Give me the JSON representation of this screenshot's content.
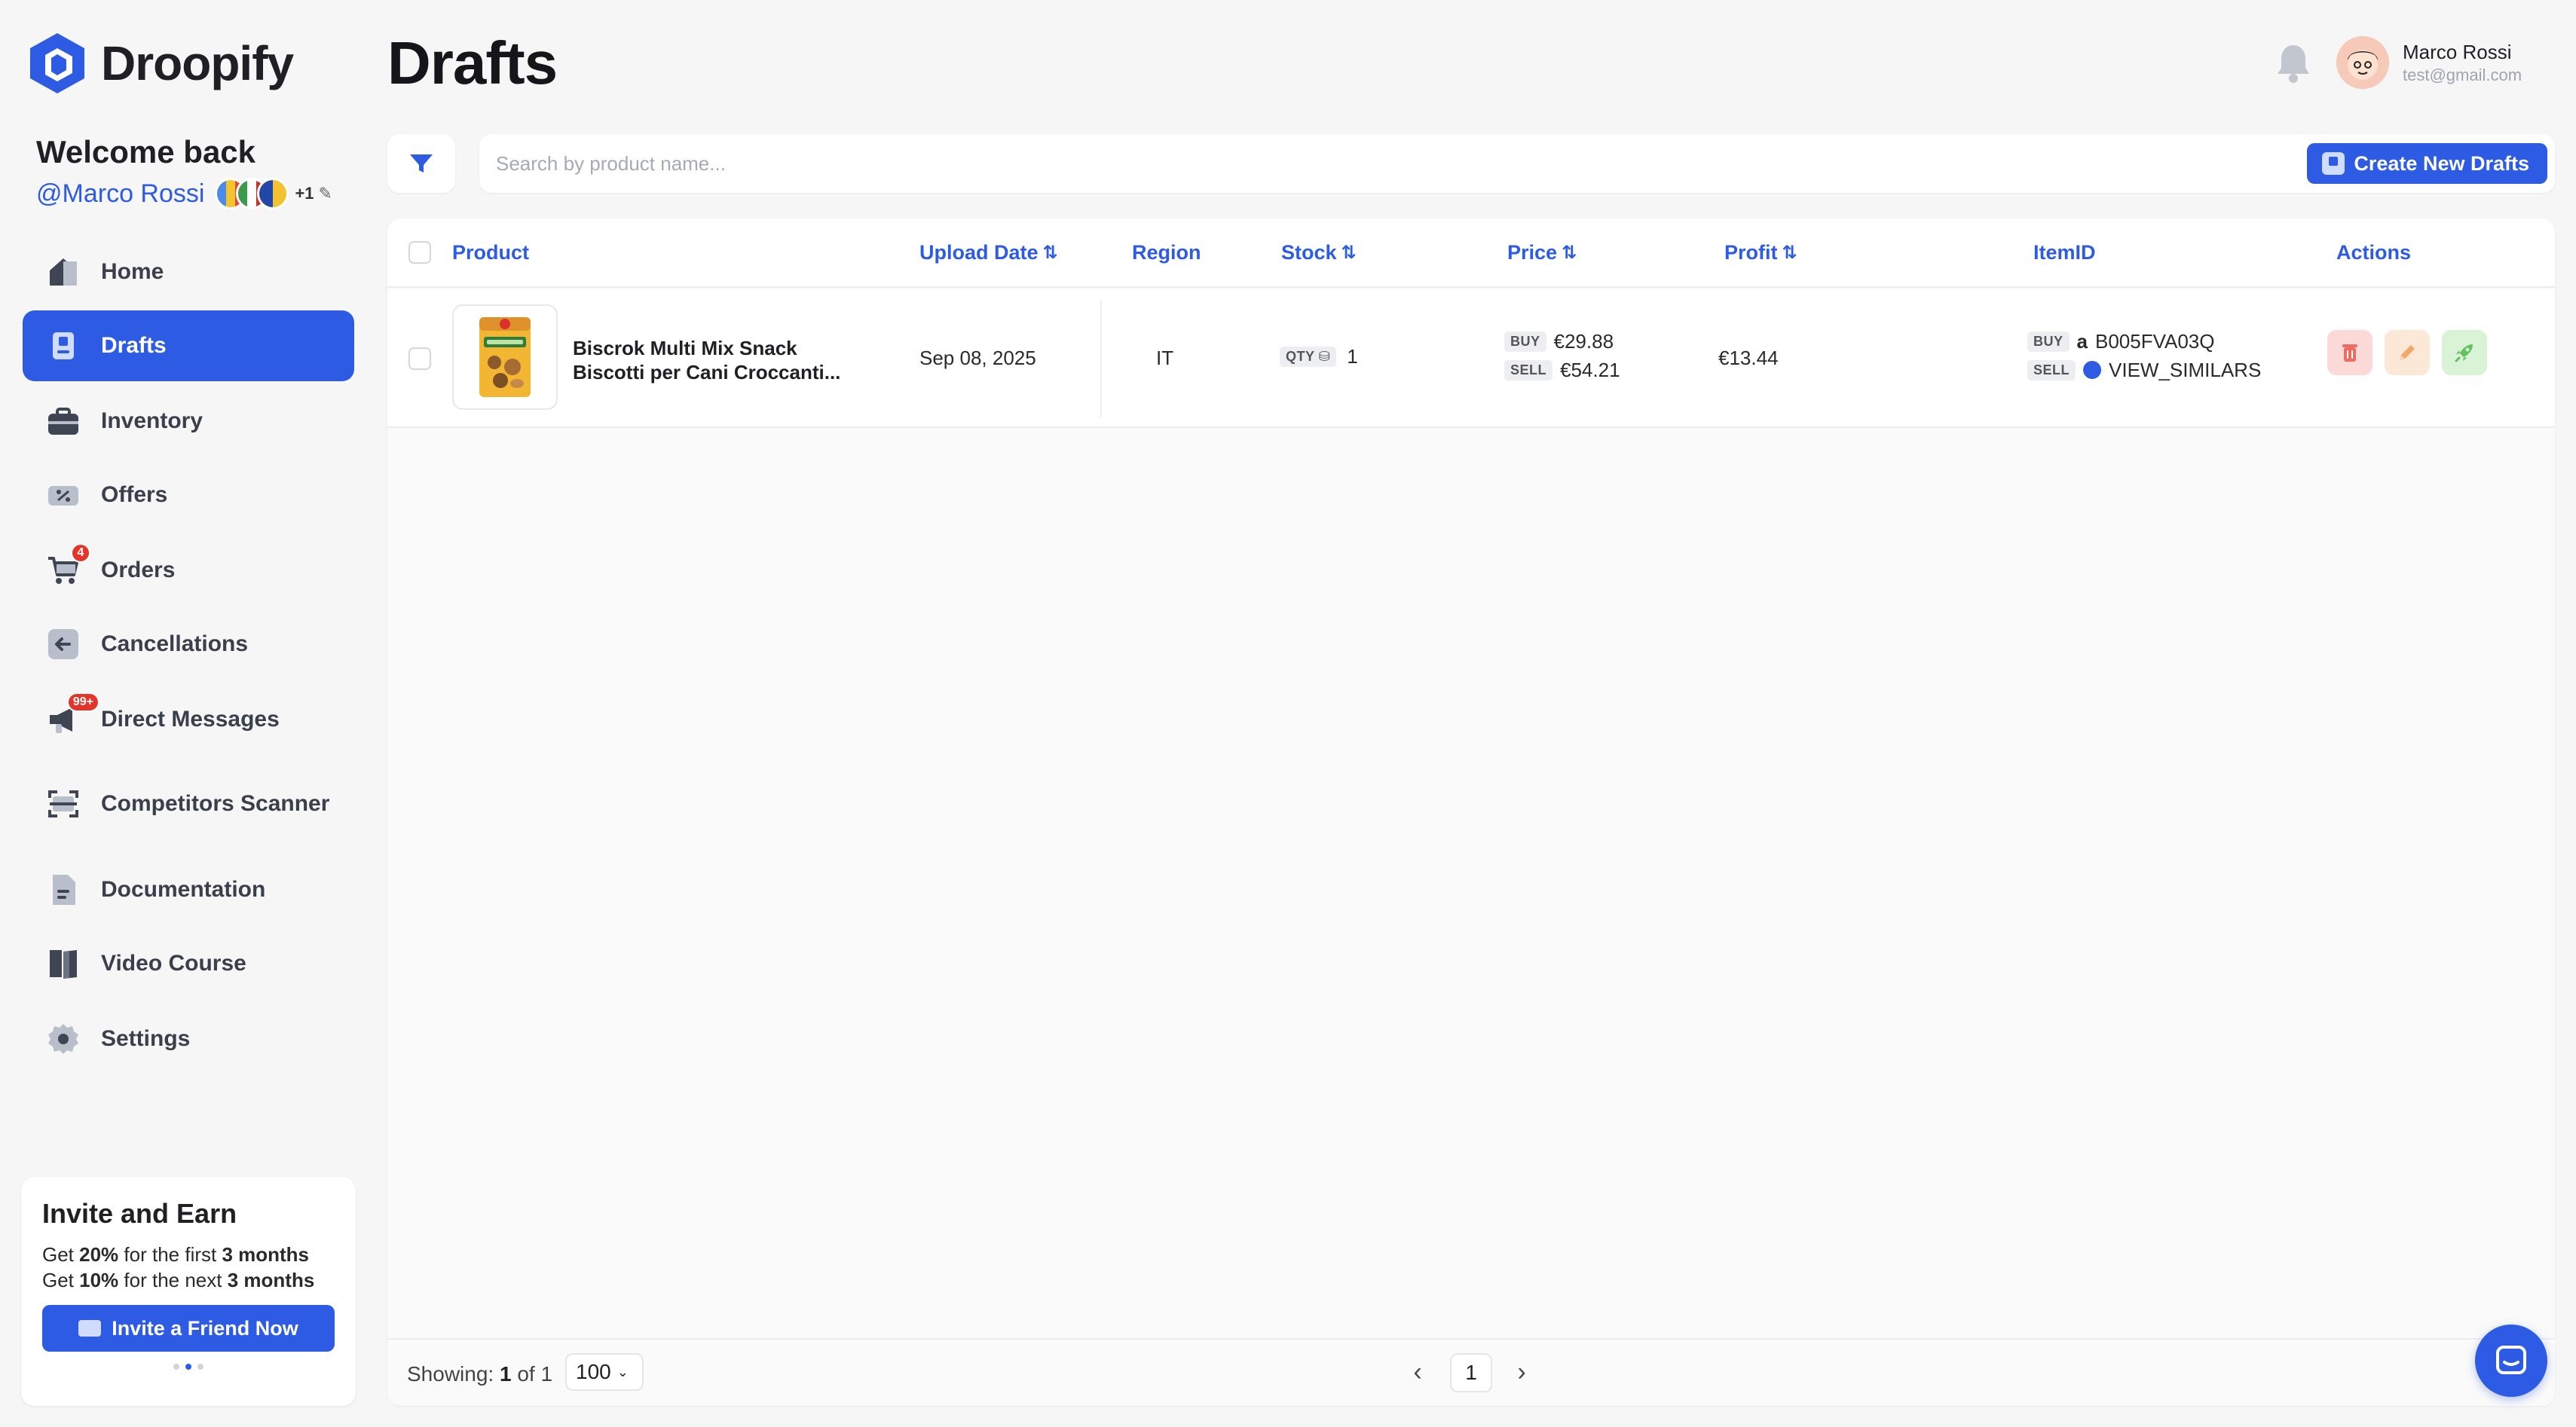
{
  "brand": {
    "name": "Droopify"
  },
  "sidebar": {
    "welcome": "Welcome back",
    "user_handle": "@Marco Rossi",
    "marketplaces_more": "+1",
    "items": [
      {
        "label": "Home",
        "icon": "home-icon"
      },
      {
        "label": "Drafts",
        "icon": "drafts-icon",
        "active": true
      },
      {
        "label": "Inventory",
        "icon": "briefcase-icon"
      },
      {
        "label": "Offers",
        "icon": "ticket-icon"
      },
      {
        "label": "Orders",
        "icon": "cart-icon",
        "badge": "4"
      },
      {
        "label": "Cancellations",
        "icon": "arrow-left-icon"
      },
      {
        "label": "Direct Messages",
        "icon": "megaphone-icon",
        "badge": "99+"
      },
      {
        "label": "Competitors Scanner",
        "icon": "scanner-icon"
      },
      {
        "label": "Documentation",
        "icon": "document-icon"
      },
      {
        "label": "Video Course",
        "icon": "book-icon"
      },
      {
        "label": "Settings",
        "icon": "gear-icon"
      }
    ],
    "invite": {
      "title": "Invite and Earn",
      "line1_pre": "Get ",
      "line1_pct": "20%",
      "line1_mid": " for the first ",
      "line1_dur": "3 months",
      "line2_pre": "Get ",
      "line2_pct": "10%",
      "line2_mid": " for the next ",
      "line2_dur": "3 months",
      "button": "Invite a Friend Now"
    }
  },
  "header": {
    "title": "Drafts",
    "user_name": "Marco Rossi",
    "user_email": "test@gmail.com"
  },
  "toolbar": {
    "search_placeholder": "Search by product name...",
    "create_button": "Create New Drafts"
  },
  "table": {
    "columns": {
      "product": "Product",
      "upload_date": "Upload Date",
      "region": "Region",
      "stock": "Stock",
      "price": "Price",
      "profit": "Profit",
      "item_id": "ItemID",
      "actions": "Actions"
    },
    "rows": [
      {
        "name_line1": "Biscrok Multi Mix Snack",
        "name_line2": "Biscotti per Cani Croccanti...",
        "upload_date": "Sep 08, 2025",
        "region": "IT",
        "qty_tag": "QTY",
        "qty": "1",
        "buy_tag": "BUY",
        "buy_price": "€29.88",
        "sell_tag": "SELL",
        "sell_price": "€54.21",
        "profit": "€13.44",
        "buy_id": "B005FVA03Q",
        "sell_id": "VIEW_SIMILARS"
      }
    ]
  },
  "footer": {
    "showing_label": "Showing:",
    "showing_current": "1",
    "showing_of": "of 1",
    "per_page": "100",
    "current_page": "1"
  },
  "colors": {
    "accent": "#2d5be3",
    "danger": "#e5342c"
  }
}
